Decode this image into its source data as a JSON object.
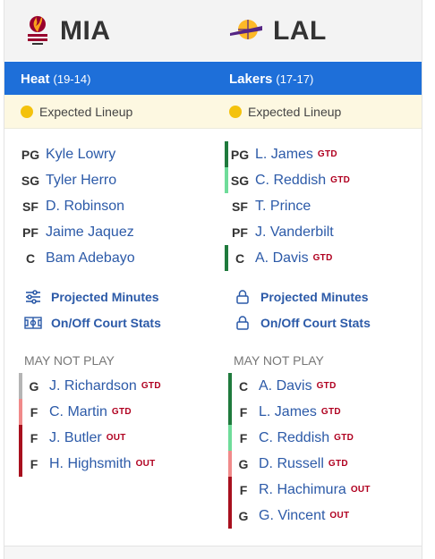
{
  "away": {
    "abbr": "MIA",
    "bar_name": "Heat",
    "record": "(19-14)",
    "status": "Expected Lineup",
    "starters": [
      {
        "pos": "PG",
        "name": "Kyle Lowry",
        "tag": ""
      },
      {
        "pos": "SG",
        "name": "Tyler Herro",
        "tag": ""
      },
      {
        "pos": "SF",
        "name": "D. Robinson",
        "tag": ""
      },
      {
        "pos": "PF",
        "name": "Jaime Jaquez",
        "tag": ""
      },
      {
        "pos": "C",
        "name": "Bam Adebayo",
        "tag": ""
      }
    ],
    "links": {
      "minutes": "Projected Minutes",
      "onoff": "On/Off Court Stats"
    },
    "may_not_play_label": "MAY NOT PLAY",
    "may_not_play": [
      {
        "pos": "G",
        "name": "J. Richardson",
        "tag": "GTD",
        "color": "#b5b5b5"
      },
      {
        "pos": "F",
        "name": "C. Martin",
        "tag": "GTD",
        "color": "#f08a8a"
      },
      {
        "pos": "F",
        "name": "J. Butler",
        "tag": "OUT",
        "color": "#a8101e"
      },
      {
        "pos": "F",
        "name": "H. Highsmith",
        "tag": "OUT",
        "color": "#a8101e"
      }
    ]
  },
  "home": {
    "abbr": "LAL",
    "bar_name": "Lakers",
    "record": "(17-17)",
    "status": "Expected Lineup",
    "starters": [
      {
        "pos": "PG",
        "name": "L. James",
        "tag": "GTD",
        "color": "#1f7a3d"
      },
      {
        "pos": "SG",
        "name": "C. Reddish",
        "tag": "GTD",
        "color": "#6fdc9a"
      },
      {
        "pos": "SF",
        "name": "T. Prince",
        "tag": "",
        "color": ""
      },
      {
        "pos": "PF",
        "name": "J. Vanderbilt",
        "tag": "",
        "color": ""
      },
      {
        "pos": "C",
        "name": "A. Davis",
        "tag": "GTD",
        "color": "#1f7a3d"
      }
    ],
    "links": {
      "minutes": "Projected Minutes",
      "onoff": "On/Off Court Stats"
    },
    "may_not_play_label": "MAY NOT PLAY",
    "may_not_play": [
      {
        "pos": "C",
        "name": "A. Davis",
        "tag": "GTD",
        "color": "#1f7a3d"
      },
      {
        "pos": "F",
        "name": "L. James",
        "tag": "GTD",
        "color": "#1f7a3d"
      },
      {
        "pos": "F",
        "name": "C. Reddish",
        "tag": "GTD",
        "color": "#6fdc9a"
      },
      {
        "pos": "G",
        "name": "D. Russell",
        "tag": "GTD",
        "color": "#f08a8a"
      },
      {
        "pos": "F",
        "name": "R. Hachimura",
        "tag": "OUT",
        "color": "#a8101e"
      },
      {
        "pos": "G",
        "name": "G. Vincent",
        "tag": "OUT",
        "color": "#a8101e"
      }
    ]
  },
  "icons": {
    "heat_logo": "heat-logo-icon",
    "lakers_logo": "lakers-logo-icon",
    "minutes": "sliders-icon",
    "onoff": "court-icon",
    "locked": "lock-icon"
  },
  "colors": {
    "accent": "#1e6fd9",
    "link": "#2c5aa8",
    "status_dot": "#f4c20d",
    "tag": "#b00020"
  }
}
